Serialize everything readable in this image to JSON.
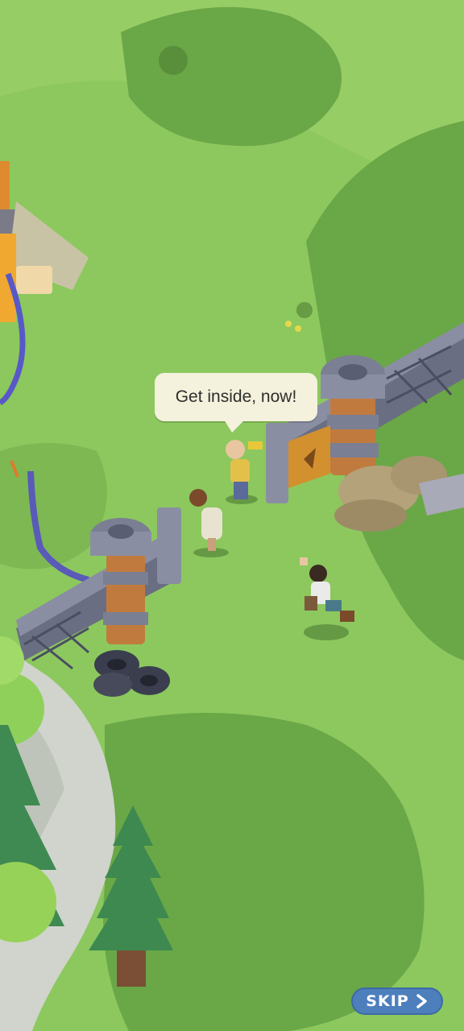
{
  "dialogue": {
    "speech_text": "Get inside, now!"
  },
  "controls": {
    "skip_label": "SKIP",
    "skip_icon": "chevron-right-icon"
  },
  "colors": {
    "grass": "#86c45a",
    "dark_grass": "#5f9a3e",
    "bubble": "#f4f1dc",
    "skip_button": "#4d7fbd"
  }
}
